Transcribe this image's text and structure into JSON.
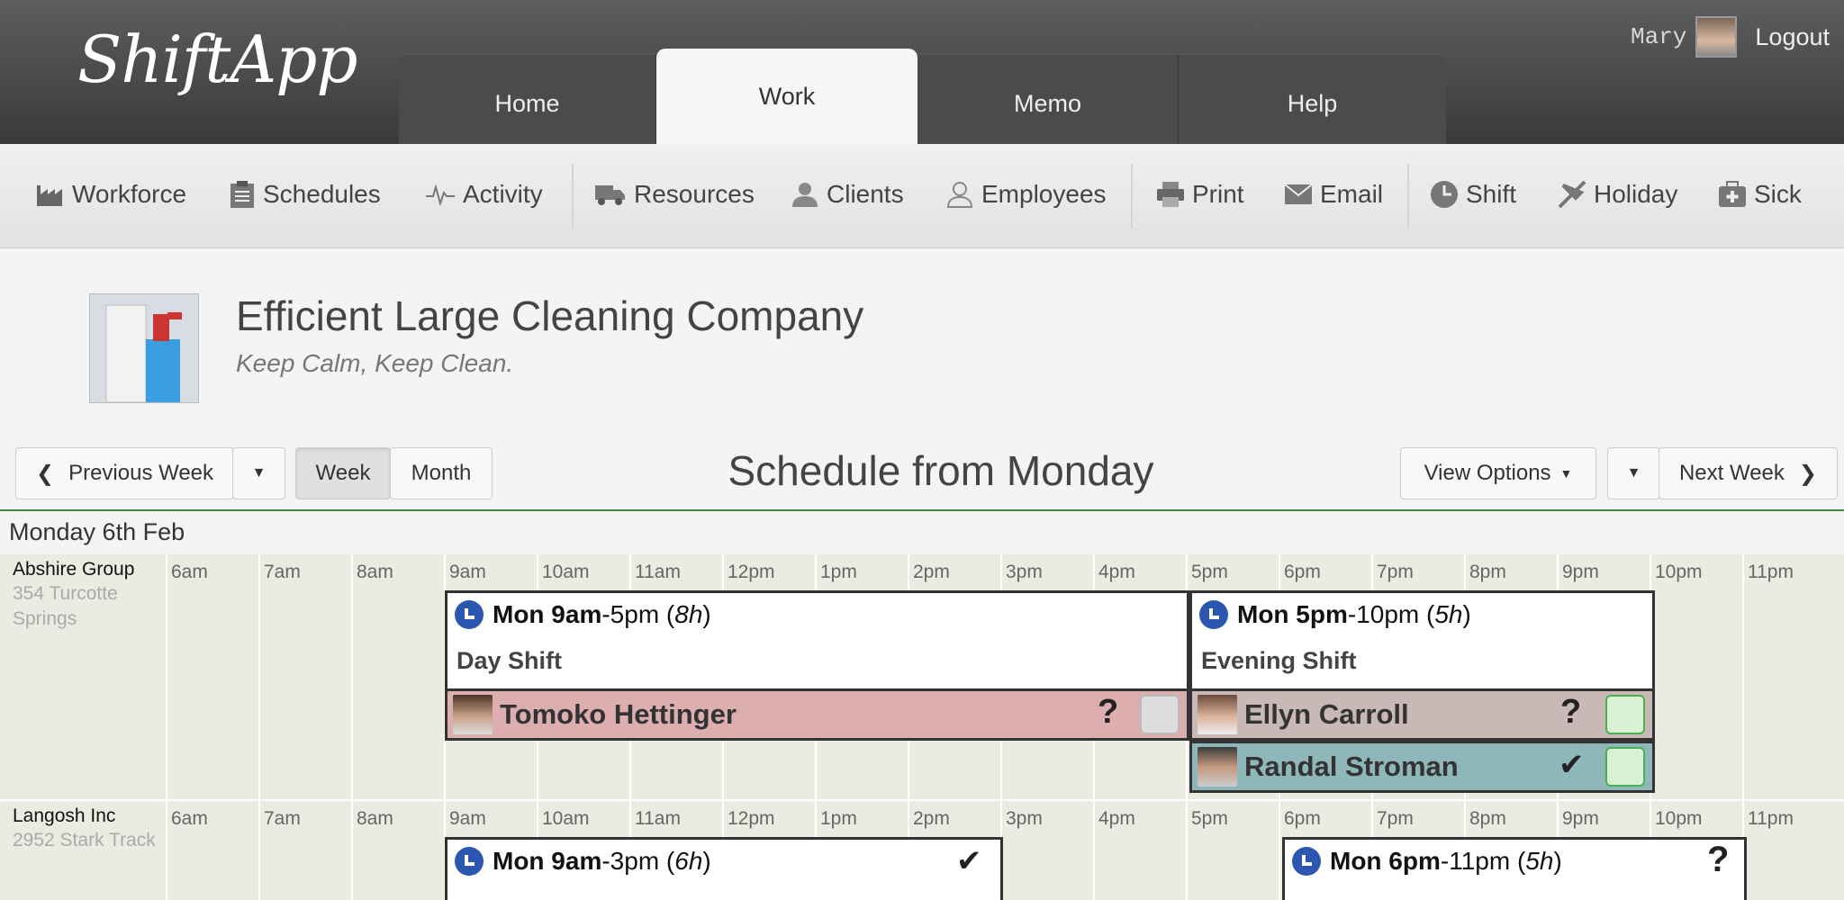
{
  "app": {
    "logo": "ShiftApp"
  },
  "nav_tabs": [
    "Home",
    "Work",
    "Memo",
    "Help"
  ],
  "user": {
    "name": "Mary",
    "logout": "Logout"
  },
  "toolbar": {
    "workforce": "Workforce",
    "schedules": "Schedules",
    "activity": "Activity",
    "resources": "Resources",
    "clients": "Clients",
    "employees": "Employees",
    "print": "Print",
    "email": "Email",
    "shift": "Shift",
    "holiday": "Holiday",
    "sick": "Sick"
  },
  "company": {
    "name": "Efficient Large Cleaning Company",
    "tagline": "Keep Calm, Keep Clean."
  },
  "controls": {
    "previous_week": "Previous Week",
    "week": "Week",
    "month": "Month",
    "title": "Schedule from Monday",
    "view_options": "View Options",
    "next_week": "Next Week"
  },
  "day": "Monday 6th Feb",
  "hours": [
    "6am",
    "7am",
    "8am",
    "9am",
    "10am",
    "11am",
    "12pm",
    "1pm",
    "2pm",
    "3pm",
    "4pm",
    "5pm",
    "6pm",
    "7pm",
    "8pm",
    "9pm",
    "10pm",
    "11pm"
  ],
  "locations": [
    {
      "name": "Abshire Group",
      "address": "354 Turcotte Springs"
    },
    {
      "name": "Langosh Inc",
      "address": "2952 Stark Track"
    }
  ],
  "shifts": {
    "day": {
      "start": "Mon 9am",
      "rest": "-5pm (",
      "dur": "8h",
      "close": ")",
      "name": "Day Shift"
    },
    "evening": {
      "start": "Mon 5pm",
      "rest": "-10pm (",
      "dur": "5h",
      "close": ")",
      "name": "Evening Shift"
    },
    "l1": {
      "start": "Mon 9am",
      "rest": "-3pm (",
      "dur": "6h",
      "close": ")",
      "status": "✔"
    },
    "l2": {
      "start": "Mon 6pm",
      "rest": "-11pm (",
      "dur": "5h",
      "close": ")",
      "status": "?"
    }
  },
  "assignments": [
    {
      "name": "Tomoko Hettinger",
      "status": "?"
    },
    {
      "name": "Ellyn Carroll",
      "status": "?"
    },
    {
      "name": "Randal Stroman",
      "status": "✔"
    }
  ],
  "colors": {
    "accent": "#2b57b0",
    "unconfirmed": "#dcaeb0",
    "pending": "#c8b8b6",
    "confirmed": "#8fb6b9",
    "check_box": "#d9f2d4"
  }
}
